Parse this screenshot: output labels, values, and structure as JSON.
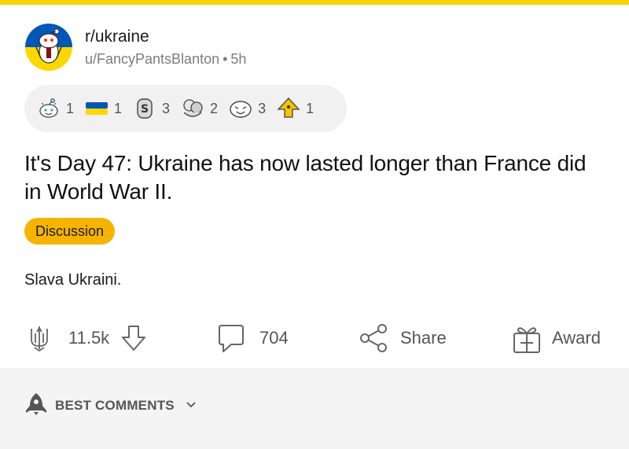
{
  "post": {
    "subreddit": "r/ukraine",
    "author": "u/FancyPantsBlanton",
    "separator": "•",
    "age": "5h",
    "title": "It's Day 47: Ukraine has now lasted longer than France did in World War II.",
    "flair": "Discussion",
    "body": "Slava Ukraini."
  },
  "awards": [
    {
      "icon": "snoo-award-icon",
      "count": "1"
    },
    {
      "icon": "ukraine-flag-icon",
      "count": "1"
    },
    {
      "icon": "silver-coin-icon",
      "count": "3"
    },
    {
      "icon": "wholesome-hug-icon",
      "count": "2"
    },
    {
      "icon": "laughing-face-icon",
      "count": "3"
    },
    {
      "icon": "helpful-award-icon",
      "count": "1"
    }
  ],
  "actions": {
    "score": "11.5k",
    "comments": "704",
    "share": "Share",
    "award": "Award"
  },
  "comments_sort": {
    "label": "BEST COMMENTS"
  },
  "colors": {
    "accent_strip": "#f7d300",
    "flair_bg": "#f6b400",
    "ukraine_blue": "#0057b7",
    "ukraine_yellow": "#ffd700"
  }
}
